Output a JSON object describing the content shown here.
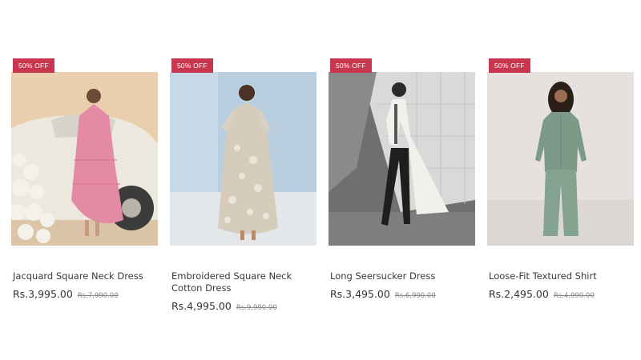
{
  "products": [
    {
      "badge": "50% OFF",
      "name": "Jacquard Square Neck Dress",
      "price": "Rs.3,995.00",
      "original_price": "Rs.7,990.00",
      "image": "model-pink-tiered-dress-beside-vintage-car"
    },
    {
      "badge": "50% OFF",
      "name": "Embroidered Square Neck Cotton Dress",
      "price": "Rs.4,995.00",
      "original_price": "Rs.9,990.00",
      "image": "model-beige-floral-maxi-dress"
    },
    {
      "badge": "50% OFF",
      "name": "Long Seersucker Dress",
      "price": "Rs.3,495.00",
      "original_price": "Rs.6,990.00",
      "image": "model-white-long-shirt-dress-walking"
    },
    {
      "badge": "50% OFF",
      "name": "Loose-Fit Textured Shirt",
      "price": "Rs.2,495.00",
      "original_price": "Rs.4,990.00",
      "image": "model-sage-green-shirt-and-trousers"
    }
  ],
  "colors": {
    "badge": "#c8374f",
    "text": "#3a3a3a",
    "strike": "#888888"
  }
}
